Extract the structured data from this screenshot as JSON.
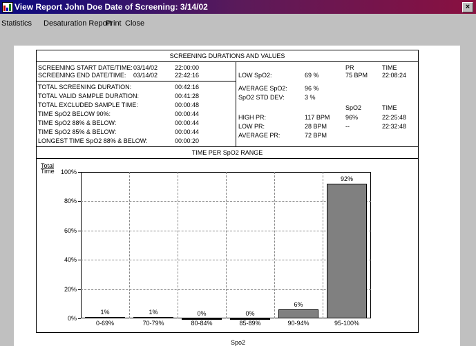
{
  "window": {
    "title": "View Report  John Doe      Date of Screening: 3/14/02",
    "close_glyph": "×"
  },
  "menu": [
    "Statistics",
    "Desaturation Report",
    "Print",
    "Close"
  ],
  "report": {
    "section1_title": "SCREENING DURATIONS AND VALUES",
    "start_label": "SCREENING START DATE/TIME:",
    "start_date": "03/14/02",
    "start_time": "22:00:00",
    "end_label": "SCREENING END DATE/TIME:",
    "end_date": "03/14/02",
    "end_time": "22:42:16",
    "left_rows": [
      {
        "label": "TOTAL SCREENING DURATION:",
        "value": "00:42:16"
      },
      {
        "label": "TOTAL VALID SAMPLE DURATION:",
        "value": "00:41:28"
      },
      {
        "label": "TOTAL EXCLUDED SAMPLE TIME:",
        "value": "00:00:48"
      },
      {
        "label": "TIME SpO2 BELOW 90%:",
        "value": "00:00:44"
      },
      {
        "label": "TIME SpO2 88% & BELOW:",
        "value": "00:00:44"
      },
      {
        "label": "TIME SpO2 85% & BELOW:",
        "value": "00:00:44"
      },
      {
        "label": "LONGEST TIME SpO2 88% & BELOW:",
        "value": "00:00:20"
      }
    ],
    "right": {
      "pr_header": "PR",
      "time_header": "TIME",
      "low_spo2_label": "LOW SpO2:",
      "low_spo2_value": "69 %",
      "low_spo2_pr": "75 BPM",
      "low_spo2_time": "22:08:24",
      "avg_spo2_label": "AVERAGE SpO2:",
      "avg_spo2_value": "96 %",
      "std_label": "SpO2 STD DEV:",
      "std_value": "3 %",
      "spo2_header": "SpO2",
      "time_header2": "TIME",
      "high_pr_label": "HIGH PR:",
      "high_pr_value": "117 BPM",
      "high_pr_spo2": "96%",
      "high_pr_time": "22:25:48",
      "low_pr_label": "LOW PR:",
      "low_pr_value": "28 BPM",
      "low_pr_spo2": "--",
      "low_pr_time": "22:32:48",
      "avg_pr_label": "AVERAGE PR:",
      "avg_pr_value": "72 BPM"
    },
    "section2_title": "TIME PER SpO2 RANGE",
    "ylabel_line1": "Total",
    "ylabel_line2": "Time",
    "xlabel": "Spo2"
  },
  "chart_data": {
    "type": "bar",
    "title": "TIME PER SpO2 RANGE",
    "categories": [
      "0-69%",
      "70-79%",
      "80-84%",
      "85-89%",
      "90-94%",
      "95-100%"
    ],
    "values": [
      1,
      1,
      0,
      0,
      6,
      92
    ],
    "value_labels": [
      "1%",
      "1%",
      "0%",
      "0%",
      "6%",
      "92%"
    ],
    "ylabel": "Total Time",
    "xlabel": "Spo2",
    "ylim": [
      0,
      100
    ],
    "yticks": [
      "0%",
      "20%",
      "40%",
      "60%",
      "80%",
      "100%"
    ],
    "ytick_values": [
      0,
      20,
      40,
      60,
      80,
      100
    ],
    "grid": true,
    "bar_color": "#808080"
  }
}
